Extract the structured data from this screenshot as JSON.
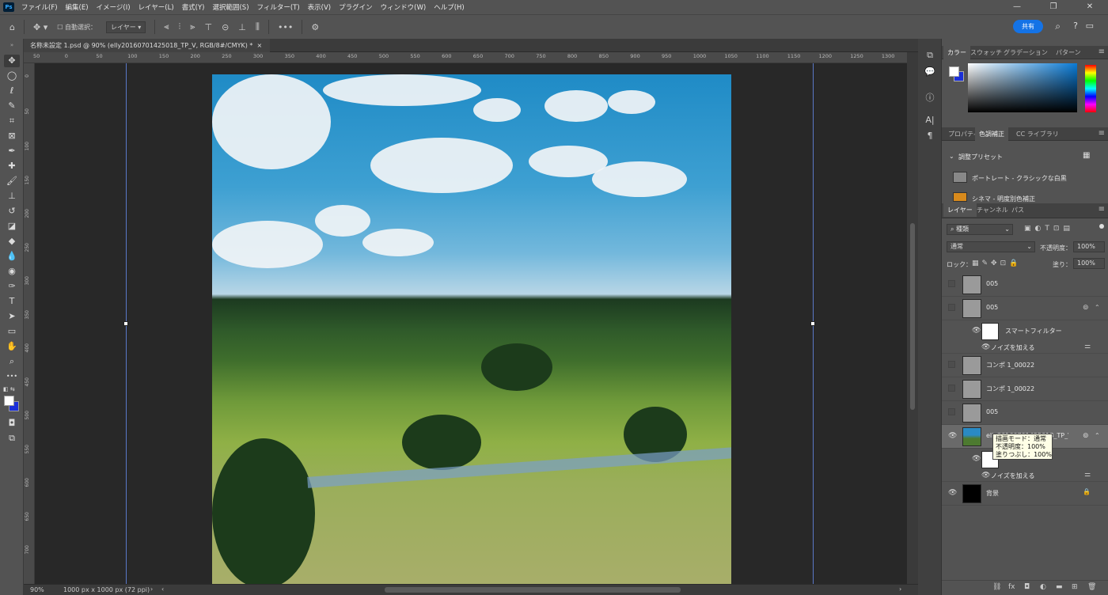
{
  "menubar": {
    "app_logo": "Ps",
    "items": [
      "ファイル(F)",
      "編集(E)",
      "イメージ(I)",
      "レイヤー(L)",
      "書式(Y)",
      "選択範囲(S)",
      "フィルター(T)",
      "表示(V)",
      "プラグイン",
      "ウィンドウ(W)",
      "ヘルプ(H)"
    ],
    "window_controls": [
      "—",
      "❐",
      "✕"
    ]
  },
  "options": {
    "auto_select_label": "自動選択：",
    "auto_select_target": "レイヤー",
    "share_label": "共有"
  },
  "document": {
    "tab_title": "名称未設定 1.psd @ 90% (elly20160701425018_TP_V, RGB/8#/CMYK) *",
    "zoom": "90%",
    "dimensions": "1000 px x 1000 px (72 ppi)"
  },
  "ruler": {
    "h_ticks": [
      "50",
      "0",
      "50",
      "100",
      "150",
      "200",
      "250",
      "300",
      "350",
      "400",
      "450",
      "500",
      "550",
      "600",
      "650",
      "700",
      "750",
      "800",
      "850",
      "900",
      "950",
      "1000",
      "1050",
      "1100",
      "1150",
      "1200",
      "1250",
      "1300"
    ],
    "v_ticks": [
      "0",
      "50",
      "100",
      "150",
      "200",
      "250",
      "300",
      "350",
      "400",
      "450",
      "500",
      "550",
      "600",
      "650",
      "700"
    ]
  },
  "color_panel": {
    "tabs": [
      "カラー",
      "スウォッチ",
      "グラデーション",
      "パターン"
    ],
    "foreground": "#ffffff",
    "background": "#1b2fd8"
  },
  "adjust_panel": {
    "tabs": [
      "プロパティ",
      "色調補正",
      "CC ライブラリ"
    ],
    "section_title": "調整プリセット",
    "presets": [
      "ポートレート - クラシックな白黒",
      "シネマ - 明度別色補正"
    ]
  },
  "layers_panel": {
    "tabs": [
      "レイヤー",
      "チャンネル",
      "パス"
    ],
    "filter_kind": "種類",
    "blend_mode": "通常",
    "opacity_label": "不透明度：",
    "opacity_value": "100%",
    "lock_label": "ロック：",
    "fill_label": "塗り：",
    "fill_value": "100%",
    "layers": [
      {
        "name": "005",
        "visible": false
      },
      {
        "name": "005",
        "visible": false
      },
      {
        "name": "スマートフィルター",
        "visible": true
      },
      {
        "name": "ノイズを加える",
        "visible": true
      },
      {
        "name": "コンポ 1_00022",
        "visible": false
      },
      {
        "name": "コンポ 1_00022",
        "visible": false
      },
      {
        "name": "005",
        "visible": false
      },
      {
        "name": "elly20160701425018_TP_V",
        "visible": true
      },
      {
        "name": "ノイズを加える",
        "visible": true
      },
      {
        "name": "背景",
        "visible": true
      }
    ],
    "tooltip": [
      "描画モード：通常",
      "不透明度：100%",
      "塗りつぶし：100%"
    ]
  }
}
